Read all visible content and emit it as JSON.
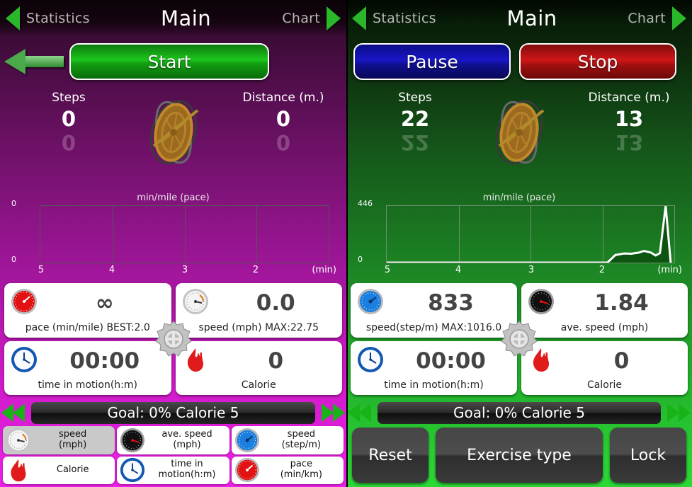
{
  "left": {
    "header": {
      "back_label": "Statistics",
      "title": "Main",
      "forward_label": "Chart",
      "back_icon": "triangle-left-icon",
      "forward_icon": "triangle-right-icon"
    },
    "back_arrow_icon": "arrow-left-icon",
    "primary_button": "Start",
    "metrics": {
      "steps_label": "Steps",
      "steps_value": "0",
      "distance_label": "Distance (m.)",
      "distance_value": "0",
      "wheel_icon": "gyro-wheel-icon"
    },
    "chart": {
      "title": "min/mile (pace)",
      "y_top": "0",
      "y_bottom": "0",
      "x1": "5",
      "x2": "4",
      "x3": "3",
      "x4": "2",
      "x_unit": "(min)"
    },
    "cards": [
      {
        "icon": "red-gauge-icon",
        "value": "∞",
        "label": "pace (min/mile) BEST:2.0"
      },
      {
        "icon": "white-gauge-icon",
        "value": "0.0",
        "label": "speed (mph) MAX:22.75"
      },
      {
        "icon": "blue-clock-icon",
        "value": "00:00",
        "label": "time in motion(h:m)"
      },
      {
        "icon": "flame-icon",
        "value": "0",
        "label": "Calorie"
      }
    ],
    "gear_icon": "gear-plus-icon",
    "goal": {
      "prev_icon": "double-arrow-left-icon",
      "text": "Goal: 0%  Calorie  5",
      "next_icon": "double-arrow-right-icon"
    },
    "selector": [
      {
        "icon": "white-gauge-icon",
        "line1": "speed",
        "line2": "(mph)",
        "selected": true
      },
      {
        "icon": "black-gauge-icon",
        "line1": "ave. speed",
        "line2": "(mph)",
        "selected": false
      },
      {
        "icon": "blue-gauge-icon",
        "line1": "speed",
        "line2": "(step/m)",
        "selected": false
      },
      {
        "icon": "flame-icon",
        "line1": "Calorie",
        "line2": "",
        "selected": false
      },
      {
        "icon": "blue-clock-icon",
        "line1": "time in",
        "line2": "motion(h:m)",
        "selected": false
      },
      {
        "icon": "red-gauge-icon",
        "line1": "pace",
        "line2": "(min/km)",
        "selected": false
      }
    ]
  },
  "right": {
    "header": {
      "back_label": "Statistics",
      "title": "Main",
      "forward_label": "Chart",
      "back_icon": "triangle-left-icon",
      "forward_icon": "triangle-right-icon"
    },
    "pause_button": "Pause",
    "stop_button": "Stop",
    "metrics": {
      "steps_label": "Steps",
      "steps_value": "22",
      "distance_label": "Distance (m.)",
      "distance_value": "13",
      "wheel_icon": "gyro-wheel-icon"
    },
    "chart": {
      "title": "min/mile (pace)",
      "y_top": "446",
      "y_bottom": "0",
      "x1": "5",
      "x2": "4",
      "x3": "3",
      "x4": "2",
      "x_unit": "(min)"
    },
    "cards": [
      {
        "icon": "blue-gauge-icon",
        "value": "833",
        "label": "speed(step/m) MAX:1016.0"
      },
      {
        "icon": "black-gauge-icon",
        "value": "1.84",
        "label": "ave. speed (mph)"
      },
      {
        "icon": "blue-clock-icon",
        "value": "00:00",
        "label": "time in motion(h:m)"
      },
      {
        "icon": "flame-icon",
        "value": "0",
        "label": "Calorie"
      }
    ],
    "gear_icon": "gear-plus-icon",
    "goal": {
      "prev_icon": "double-arrow-left-icon",
      "text": "Goal: 0%  Calorie  5",
      "next_icon": "double-arrow-right-icon"
    },
    "buttons": {
      "reset": "Reset",
      "exercise_type": "Exercise type",
      "lock": "Lock"
    }
  },
  "colors": {
    "purple_dark": "#2b0826",
    "purple_bright": "#ea20e4",
    "green_dark": "#071a07",
    "green_bright": "#2cd836",
    "start_green": "#1cc71c",
    "pause_blue": "#1717c6",
    "stop_red": "#cf1616",
    "arrow_green": "#2ab82a",
    "card_white": "#ffffff",
    "goal_bar": "#2a2a2a"
  },
  "chart_data": [
    {
      "type": "line",
      "title": "min/mile (pace)",
      "panel": "left",
      "xlabel": "(min)",
      "ylabel": "",
      "categories": [
        "5",
        "4",
        "3",
        "2",
        "(min)"
      ],
      "x": [
        5,
        4,
        3,
        2,
        1
      ],
      "values": [],
      "ylim": [
        0,
        0
      ],
      "ytick_labels": [
        "0",
        "0"
      ],
      "xlim": [
        5,
        1
      ],
      "grid": true,
      "legend": "none",
      "note": "empty plot, no data drawn"
    },
    {
      "type": "line",
      "title": "min/mile (pace)",
      "panel": "right",
      "xlabel": "(min)",
      "ylabel": "",
      "categories": [
        "5",
        "4",
        "3",
        "2",
        "(min)"
      ],
      "ylim": [
        0,
        446
      ],
      "ytick_labels": [
        "446",
        "0"
      ],
      "xlim": [
        5,
        1
      ],
      "grid": true,
      "legend": "none",
      "series": [
        {
          "name": "pace",
          "x": [
            5.0,
            4.0,
            3.0,
            2.05,
            1.93,
            1.82,
            1.7,
            1.6,
            1.5,
            1.42,
            1.33,
            1.26,
            1.2,
            1.12,
            1.05
          ],
          "values": [
            0,
            0,
            0,
            0,
            0,
            60,
            72,
            70,
            78,
            92,
            80,
            56,
            74,
            446,
            0
          ]
        }
      ]
    }
  ]
}
